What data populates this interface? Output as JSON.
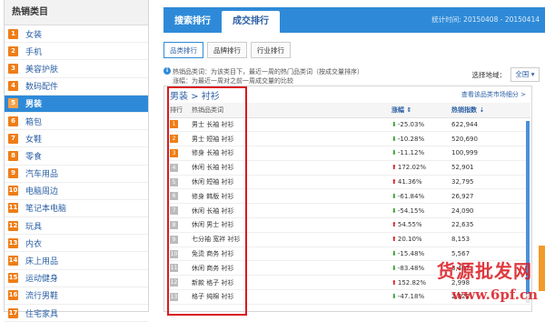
{
  "sidebar": {
    "title": "热销类目",
    "items": [
      {
        "num": "1",
        "label": "女装"
      },
      {
        "num": "2",
        "label": "手机"
      },
      {
        "num": "3",
        "label": "美容护肤"
      },
      {
        "num": "4",
        "label": "数码配件"
      },
      {
        "num": "5",
        "label": "男装"
      },
      {
        "num": "6",
        "label": "箱包"
      },
      {
        "num": "7",
        "label": "女鞋"
      },
      {
        "num": "8",
        "label": "零食"
      },
      {
        "num": "9",
        "label": "汽车用品"
      },
      {
        "num": "10",
        "label": "电脑周边"
      },
      {
        "num": "11",
        "label": "笔记本电脑"
      },
      {
        "num": "12",
        "label": "玩具"
      },
      {
        "num": "13",
        "label": "内衣"
      },
      {
        "num": "14",
        "label": "床上用品"
      },
      {
        "num": "15",
        "label": "运动健身"
      },
      {
        "num": "16",
        "label": "流行男鞋"
      },
      {
        "num": "17",
        "label": "住宅家具"
      }
    ]
  },
  "header": {
    "tab_search": "搜索排行",
    "tab_deal": "成交排行",
    "stat_time": "统计时间: 20150408 - 20150414"
  },
  "subtabs": {
    "category": "品类排行",
    "brand": "品牌排行",
    "industry": "行业排行"
  },
  "notes": {
    "line1": "热销品类词：为该类目下，最近一周的热门品类词（按成交量排序）",
    "line2": "涨幅：为最近一周对之前一周成交量的比较"
  },
  "region": {
    "label": "选择地域：",
    "value": "全国 ▾"
  },
  "panel": {
    "crumb": "男装 > 衬衫",
    "market_link": "查看该品类市场细分 >"
  },
  "table": {
    "headers": {
      "rank": "排行",
      "keyword": "热销品类词",
      "change": "涨幅",
      "sort_icon": "⇕",
      "index": "热销指数",
      "index_icon": "⇣"
    },
    "rows": [
      {
        "rank": "1",
        "word": "男士 长袖 衬衫",
        "dir": "down",
        "arrow": "⬇",
        "change": "-25.03%",
        "index": "622,944"
      },
      {
        "rank": "2",
        "word": "男士 短袖 衬衫",
        "dir": "down",
        "arrow": "⬇",
        "change": "-10.28%",
        "index": "520,690"
      },
      {
        "rank": "3",
        "word": "修身 长袖 衬衫",
        "dir": "down",
        "arrow": "⬇",
        "change": "-11.12%",
        "index": "100,999"
      },
      {
        "rank": "4",
        "word": "休闲 长袖 衬衫",
        "dir": "up",
        "arrow": "⬆",
        "change": "172.02%",
        "index": "52,901"
      },
      {
        "rank": "5",
        "word": "休闲 短袖 衬衫",
        "dir": "up",
        "arrow": "⬆",
        "change": "41.36%",
        "index": "32,795"
      },
      {
        "rank": "6",
        "word": "修身 韩版 衬衫",
        "dir": "down",
        "arrow": "⬇",
        "change": "-61.84%",
        "index": "26,927"
      },
      {
        "rank": "7",
        "word": "休闲 长袖 衬衫",
        "dir": "down",
        "arrow": "⬇",
        "change": "-54.15%",
        "index": "24,090"
      },
      {
        "rank": "8",
        "word": "休闲 男士 衬衫",
        "dir": "up",
        "arrow": "⬆",
        "change": "54.55%",
        "index": "22,635"
      },
      {
        "rank": "9",
        "word": "七分袖 宽袢 衬衫",
        "dir": "up",
        "arrow": "⬆",
        "change": "20.10%",
        "index": "8,153"
      },
      {
        "rank": "10",
        "word": "免烫 商务 衬衫",
        "dir": "down",
        "arrow": "⬇",
        "change": "-15.48%",
        "index": "5,567"
      },
      {
        "rank": "11",
        "word": "休闲 商务 衬衫",
        "dir": "down",
        "arrow": "⬇",
        "change": "-83.48%",
        "index": "3,487"
      },
      {
        "rank": "12",
        "word": "新款 格子 衬衫",
        "dir": "up",
        "arrow": "⬆",
        "change": "152.82%",
        "index": "2,998"
      },
      {
        "rank": "13",
        "word": "格子 纯棉 衬衫",
        "dir": "down",
        "arrow": "⬇",
        "change": "-47.18%",
        "index": "2,822"
      }
    ]
  },
  "watermark": {
    "text": "货源批发网",
    "url": "www.6pf.cn"
  }
}
